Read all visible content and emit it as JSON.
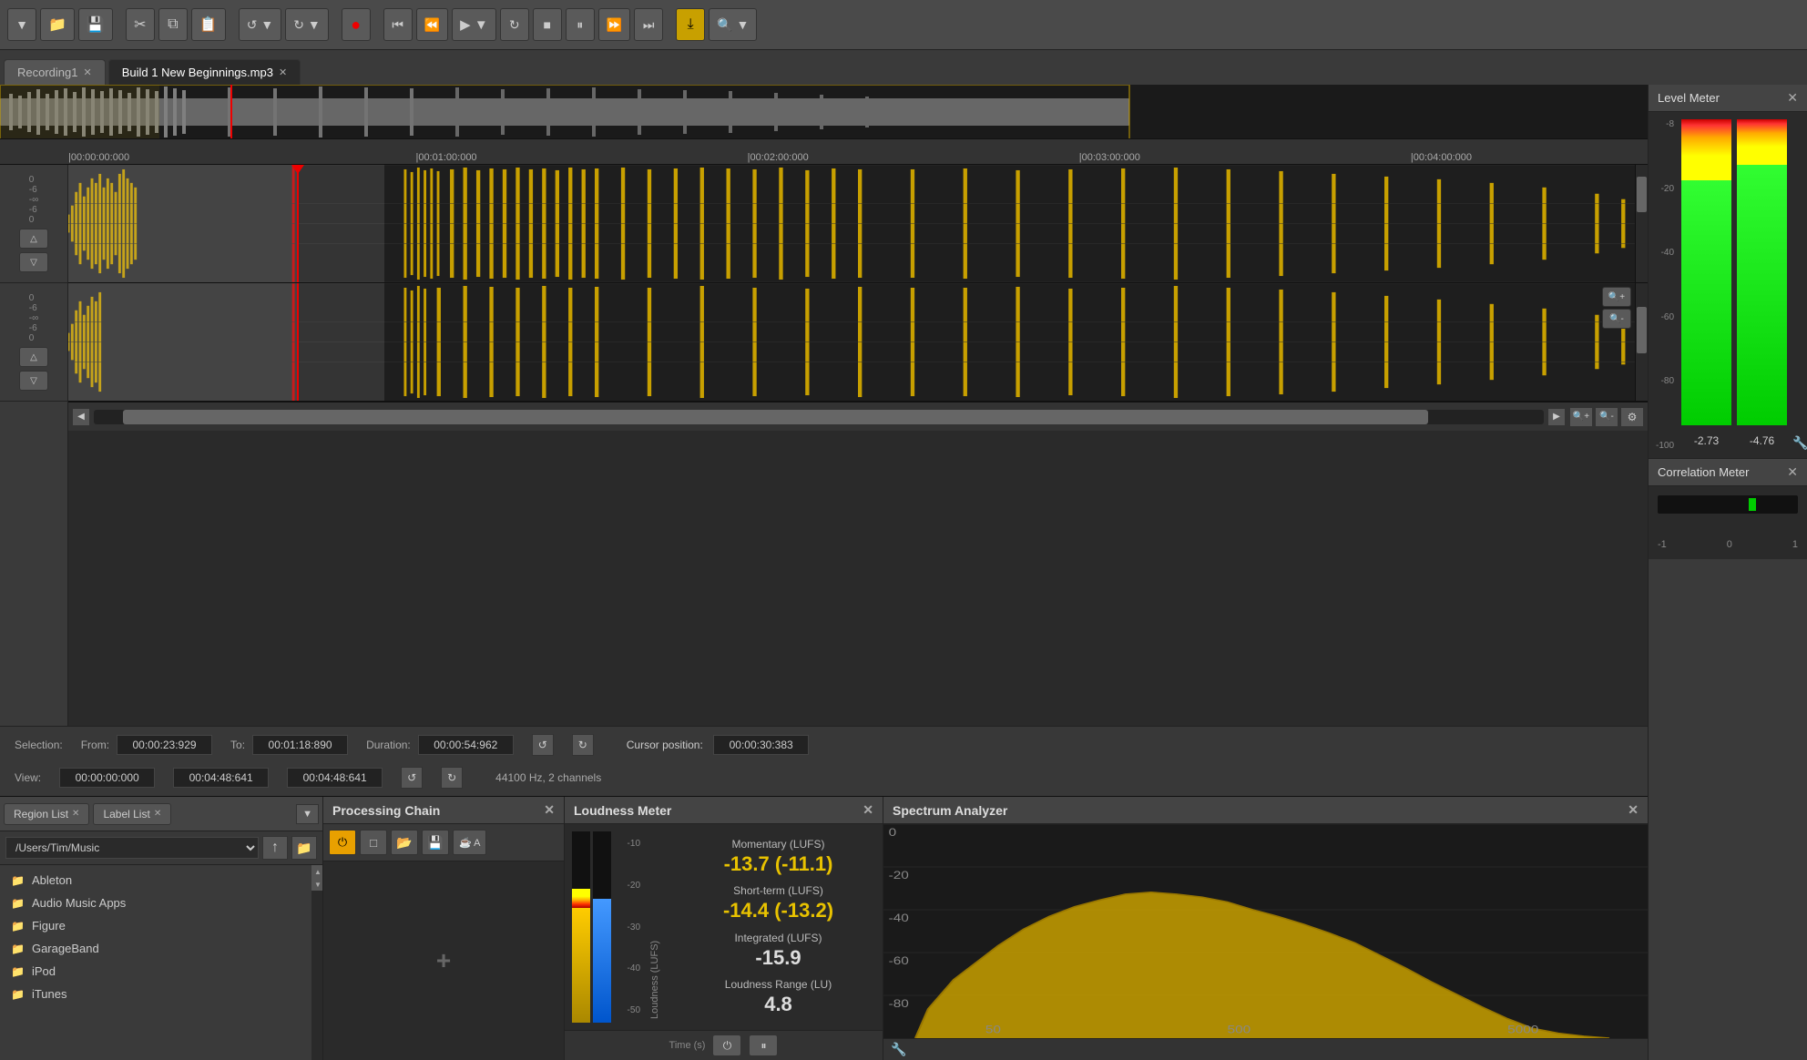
{
  "toolbar": {
    "new_label": "▼",
    "open_label": "📁",
    "save_label": "💾",
    "cut_label": "✂",
    "copy_label": "⧉",
    "paste_label": "📋",
    "undo_label": "↺",
    "undo_alt": "←",
    "redo_label": "→",
    "record_label": "●",
    "skip_start_label": "⏮",
    "rewind_label": "⏪",
    "play_label": "▶",
    "play_arrow": "▼",
    "loop_label": "↻",
    "stop_label": "■",
    "pause_label": "⏸",
    "ffwd_label": "⏩",
    "skip_end_label": "⏭",
    "snap_label": "⤓",
    "zoom_label": "🔍",
    "zoom_arrow": "▼"
  },
  "tabs": [
    {
      "label": "Recording1",
      "closable": true
    },
    {
      "label": "Build 1 New Beginnings.mp3",
      "closable": true,
      "active": true
    }
  ],
  "timeline": {
    "markers": [
      "00:00:00:000",
      "00:01:00:000",
      "00:02:00:000",
      "00:03:00:000",
      "00:04:00:000"
    ]
  },
  "selection": {
    "from_label": "From:",
    "to_label": "To:",
    "duration_label": "Duration:",
    "from_value": "00:00:23:929",
    "to_value": "00:01:18:890",
    "duration_value": "00:00:54:962",
    "cursor_label": "Cursor position:",
    "cursor_value": "00:00:30:383",
    "view_from": "00:00:00:000",
    "view_to": "00:04:48:641",
    "view_duration": "00:04:48:641",
    "freq_info": "44100 Hz, 2 channels",
    "selection_label": "Selection:",
    "view_label": "View:"
  },
  "right_panel": {
    "level_meter": {
      "title": "Level Meter",
      "scale": [
        "-8",
        "-20",
        "-40",
        "-60",
        "-80",
        "-100"
      ],
      "ch1_value": "-2.73",
      "ch2_value": "-4.76"
    },
    "correlation_meter": {
      "title": "Correlation Meter",
      "left_label": "-1",
      "center_label": "0",
      "right_label": "1"
    }
  },
  "bottom": {
    "file_browser": {
      "tab1": "Region List",
      "tab2": "Label List",
      "path": "/Users/Tim/Music",
      "items": [
        {
          "name": "Ableton",
          "type": "folder"
        },
        {
          "name": "Audio Music Apps",
          "type": "folder"
        },
        {
          "name": "Figure",
          "type": "folder"
        },
        {
          "name": "GarageBand",
          "type": "folder"
        },
        {
          "name": "iPod",
          "type": "folder"
        },
        {
          "name": "iTunes",
          "type": "folder"
        }
      ]
    },
    "processing_chain": {
      "title": "Processing Chain",
      "add_label": "+",
      "btn_power": "⏻",
      "btn_new": "□",
      "btn_open": "📂",
      "btn_save": "💾",
      "btn_extra": "☕ A"
    },
    "loudness_meter": {
      "title": "Loudness Meter",
      "momentary_label": "Momentary (LUFS)",
      "momentary_value": "-13.7 (-11.1)",
      "shortterm_label": "Short-term (LUFS)",
      "shortterm_value": "-14.4 (-13.2)",
      "integrated_label": "Integrated (LUFS)",
      "integrated_value": "-15.9",
      "range_label": "Loudness Range (LU)",
      "range_value": "4.8",
      "scale": [
        "-10",
        "-20",
        "-30",
        "-40",
        "-50"
      ],
      "x_label": "Time (s)",
      "y_label": "Loudness (LUFS)"
    },
    "spectrum_analyzer": {
      "title": "Spectrum Analyzer",
      "scale_y": [
        "0",
        "-20",
        "-40",
        "-60",
        "-80"
      ],
      "scale_x": [
        "50",
        "500",
        "5000"
      ],
      "wrench_label": "🔧"
    }
  }
}
